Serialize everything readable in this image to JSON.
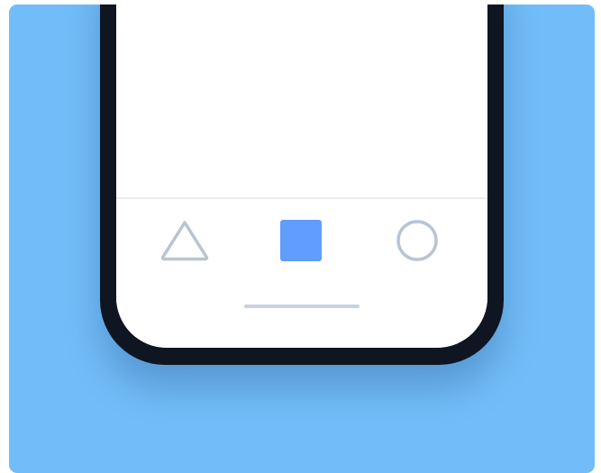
{
  "theme": {
    "background": "#72bdf9",
    "device_frame": "#0f1621",
    "screen": "#ffffff",
    "active_color": "#619cff",
    "inactive_color": "#b9c4d3",
    "home_indicator": "#c9d2de"
  },
  "tab_bar": {
    "tabs": [
      {
        "icon": "triangle-icon",
        "active": false
      },
      {
        "icon": "square-icon",
        "active": true
      },
      {
        "icon": "circle-icon",
        "active": false
      }
    ]
  }
}
